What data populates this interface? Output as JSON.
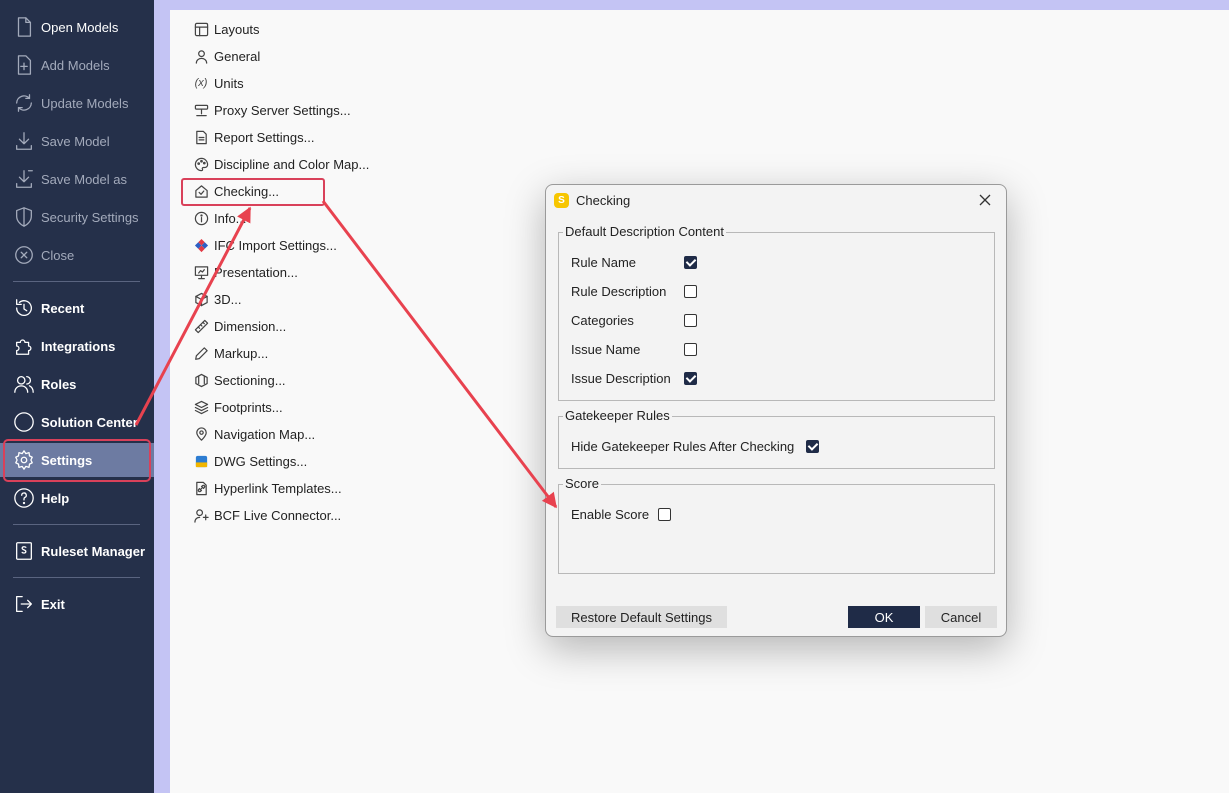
{
  "sidebar": {
    "items": [
      {
        "label": "Open Models",
        "icon": "file-icon"
      },
      {
        "label": "Add Models",
        "icon": "file-add-icon"
      },
      {
        "label": "Update Models",
        "icon": "refresh-icon"
      },
      {
        "label": "Save Model",
        "icon": "download-icon"
      },
      {
        "label": "Save Model as",
        "icon": "download-as-icon"
      },
      {
        "label": "Security Settings",
        "icon": "shield-icon"
      },
      {
        "label": "Close",
        "icon": "close-circle-icon"
      },
      {
        "label": "Recent",
        "icon": "history-icon"
      },
      {
        "label": "Integrations",
        "icon": "puzzle-icon"
      },
      {
        "label": "Roles",
        "icon": "users-icon"
      },
      {
        "label": "Solution Center",
        "icon": "circle-icon"
      },
      {
        "label": "Settings",
        "icon": "gear-icon"
      },
      {
        "label": "Help",
        "icon": "help-icon"
      },
      {
        "label": "Ruleset Manager",
        "icon": "ruleset-icon"
      },
      {
        "label": "Exit",
        "icon": "exit-icon"
      }
    ]
  },
  "settings_list": [
    {
      "label": "Layouts",
      "icon": "layout-icon"
    },
    {
      "label": "General",
      "icon": "person-icon"
    },
    {
      "label": "Units",
      "icon": "units-icon"
    },
    {
      "label": "Proxy Server Settings...",
      "icon": "server-icon"
    },
    {
      "label": "Report Settings...",
      "icon": "report-icon"
    },
    {
      "label": "Discipline and Color Map...",
      "icon": "palette-icon"
    },
    {
      "label": "Checking...",
      "icon": "checking-icon"
    },
    {
      "label": "Info...",
      "icon": "info-icon"
    },
    {
      "label": "IFC Import Settings...",
      "icon": "ifc-icon"
    },
    {
      "label": "Presentation...",
      "icon": "presentation-icon"
    },
    {
      "label": "3D...",
      "icon": "cube-icon"
    },
    {
      "label": "Dimension...",
      "icon": "ruler-icon"
    },
    {
      "label": "Markup...",
      "icon": "pen-icon"
    },
    {
      "label": "Sectioning...",
      "icon": "section-box-icon"
    },
    {
      "label": "Footprints...",
      "icon": "layers-icon"
    },
    {
      "label": "Navigation Map...",
      "icon": "map-pin-icon"
    },
    {
      "label": "DWG Settings...",
      "icon": "dwg-icon"
    },
    {
      "label": "Hyperlink Templates...",
      "icon": "hyperlink-icon"
    },
    {
      "label": "BCF Live Connector...",
      "icon": "connector-icon"
    }
  ],
  "dialog": {
    "title": "Checking",
    "app_icon_letter": "S",
    "groups": {
      "default_description": {
        "title": "Default Description Content",
        "options": [
          {
            "label": "Rule Name",
            "checked": true
          },
          {
            "label": "Rule Description",
            "checked": false
          },
          {
            "label": "Categories",
            "checked": false
          },
          {
            "label": "Issue Name",
            "checked": false
          },
          {
            "label": "Issue Description",
            "checked": true
          }
        ]
      },
      "gatekeeper": {
        "title": "Gatekeeper Rules",
        "options": [
          {
            "label": "Hide Gatekeeper Rules After Checking",
            "checked": true
          }
        ]
      },
      "score": {
        "title": "Score",
        "options": [
          {
            "label": "Enable Score",
            "checked": false
          }
        ]
      }
    },
    "buttons": {
      "restore": "Restore Default Settings",
      "ok": "OK",
      "cancel": "Cancel"
    }
  },
  "colors": {
    "sidebar_bg": "#25304a",
    "highlight_red": "#d9415a",
    "accent_dark": "#1f2b47",
    "app_icon": "#f7c600"
  }
}
